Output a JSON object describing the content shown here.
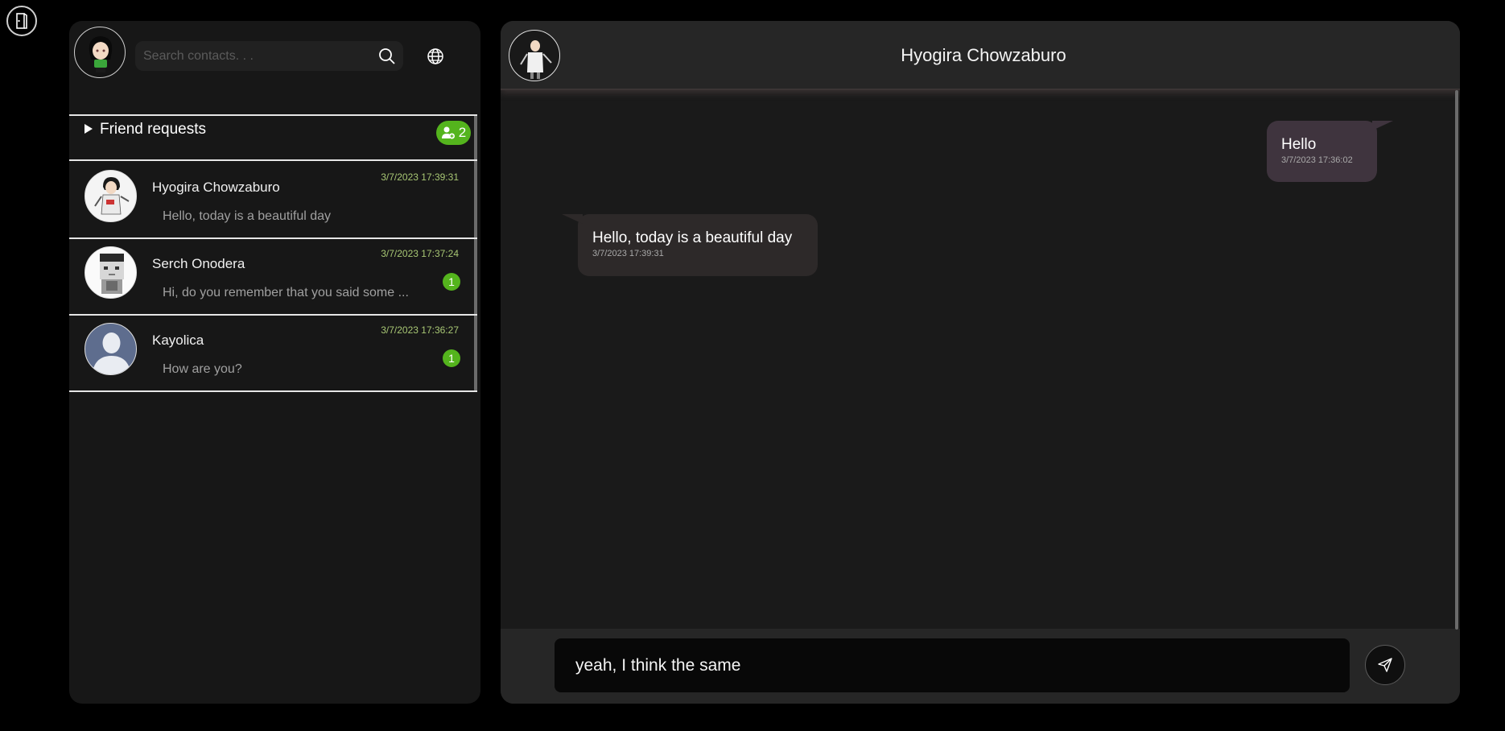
{
  "app": {
    "logout_icon": "door-exit-icon"
  },
  "sidebar": {
    "user_avatar_icon": "anime-girl-avatar",
    "search": {
      "placeholder": "Search contacts. . .",
      "value": "",
      "icon": "search-icon"
    },
    "globe_icon": "globe-icon",
    "friend_requests": {
      "label": "Friend requests",
      "count": "2",
      "icon": "add-user-icon"
    },
    "contacts": [
      {
        "name": "Hyogira Chowzaburo",
        "last_message": "Hello, today is a beautiful day",
        "time": "3/7/2023 17:39:31",
        "unread": ""
      },
      {
        "name": "Serch Onodera",
        "last_message": "Hi, do you remember that you said some ...",
        "time": "3/7/2023 17:37:24",
        "unread": "1"
      },
      {
        "name": "Kayolica",
        "last_message": "How are you?",
        "time": "3/7/2023 17:36:27",
        "unread": "1"
      }
    ]
  },
  "chat": {
    "title": "Hyogira Chowzaburo",
    "messages": [
      {
        "direction": "out",
        "text": "Hello",
        "time": "3/7/2023 17:36:02"
      },
      {
        "direction": "in",
        "text": "Hello, today is a beautiful day",
        "time": "3/7/2023 17:39:31"
      }
    ],
    "composer": {
      "value": "yeah, I think the same",
      "send_icon": "paper-plane-icon"
    }
  },
  "colors": {
    "accent_green": "#54b41d",
    "timestamp_green": "#a8c774",
    "outgoing_bubble": "#3f343e",
    "incoming_bubble": "#2d2929"
  }
}
